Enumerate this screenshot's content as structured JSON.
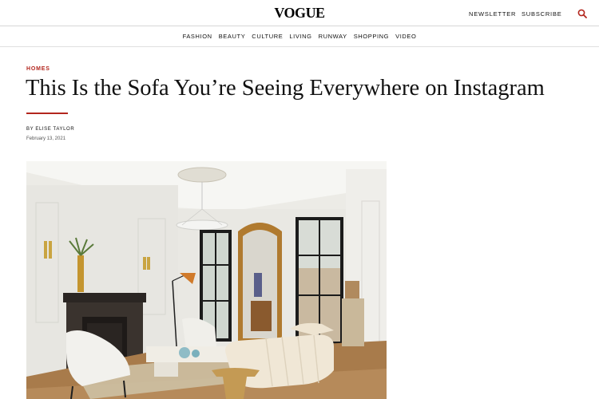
{
  "header": {
    "logo": "VOGUE",
    "newsletter_label": "NEWSLETTER",
    "subscribe_label": "SUBSCRIBE",
    "search_icon": "search-icon"
  },
  "nav": {
    "items": [
      "FASHION",
      "BEAUTY",
      "CULTURE",
      "LIVING",
      "RUNWAY",
      "SHOPPING",
      "VIDEO"
    ]
  },
  "article": {
    "rubric": "HOMES",
    "title": "This Is the Sofa You’re Seeing Everywhere on Instagram",
    "byline_prefix": "BY ",
    "author": "ELISE TAYLOR",
    "date": "February 13, 2021"
  },
  "colors": {
    "accent": "#b3261e",
    "text": "#111111"
  }
}
